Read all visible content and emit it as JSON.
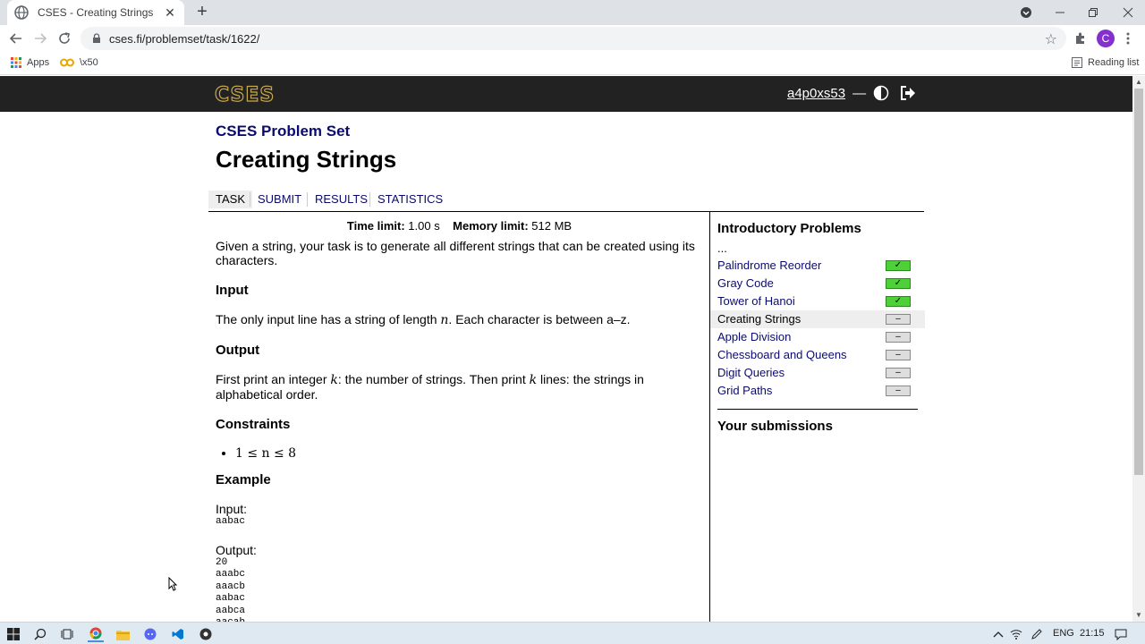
{
  "browser": {
    "tab_title": "CSES - Creating Strings",
    "tab_close": "✕",
    "new_tab": "+",
    "url": "cses.fi/problemset/task/1622/",
    "avatar_letter": "C",
    "bookmarks": {
      "apps": "Apps",
      "bookmark1": "\\x50",
      "reading_list": "Reading list"
    }
  },
  "site": {
    "logo": "CSES",
    "username": "a4p0xs53",
    "dash": "—"
  },
  "header": {
    "set_title": "CSES Problem Set",
    "task_title": "Creating Strings"
  },
  "tabs": {
    "task": "TASK",
    "submit": "SUBMIT",
    "results": "RESULTS",
    "statistics": "STATISTICS"
  },
  "limits": {
    "time_label": "Time limit:",
    "time_value": "1.00 s",
    "memory_label": "Memory limit:",
    "memory_value": "512 MB"
  },
  "statement": {
    "description": "Given a string, your task is to generate all different strings that can be created using its characters.",
    "input_heading": "Input",
    "input_text_a": "The only input line has a string of length ",
    "input_var": "n",
    "input_text_b": ". Each character is between a–z.",
    "output_heading": "Output",
    "output_text_a": "First print an integer ",
    "output_var1": "k",
    "output_text_b": ": the number of strings. Then print ",
    "output_var2": "k",
    "output_text_c": " lines: the strings in alphabetical order.",
    "constraints_heading": "Constraints",
    "constraint": "1 ≤ n ≤ 8",
    "example_heading": "Example",
    "input_label": "Input:",
    "input_example": "aabac",
    "output_label": "Output:",
    "output_example": [
      "20",
      "aaabc",
      "aaacb",
      "aabac",
      "aabca",
      "aacab"
    ]
  },
  "sidebar": {
    "title": "Introductory Problems",
    "dots": "...",
    "items": [
      {
        "label": "Palindrome Reorder",
        "status": "✓"
      },
      {
        "label": "Gray Code",
        "status": "✓"
      },
      {
        "label": "Tower of Hanoi",
        "status": "✓"
      },
      {
        "label": "Creating Strings",
        "status": "–"
      },
      {
        "label": "Apple Division",
        "status": "–"
      },
      {
        "label": "Chessboard and Queens",
        "status": "–"
      },
      {
        "label": "Digit Queries",
        "status": "–"
      },
      {
        "label": "Grid Paths",
        "status": "–"
      }
    ],
    "submissions_title": "Your submissions"
  },
  "taskbar": {
    "lang": "ENG",
    "time": "21:15"
  }
}
